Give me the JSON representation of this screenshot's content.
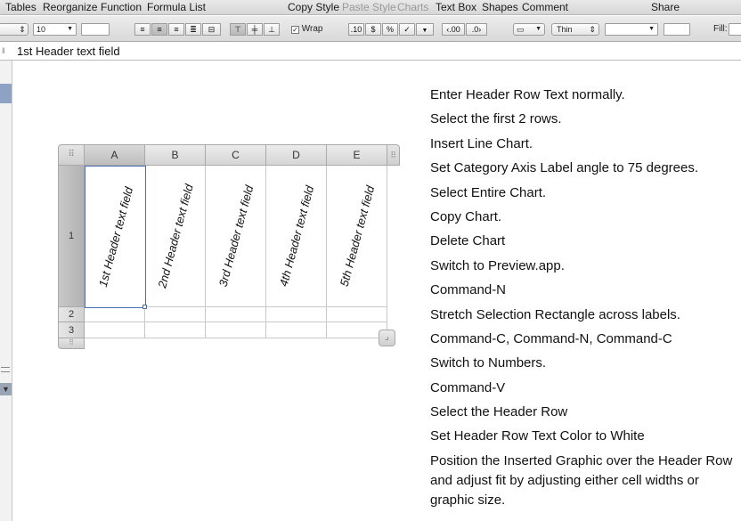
{
  "menubar": {
    "items": [
      {
        "label": "Tables",
        "dim": false
      },
      {
        "label": "Reorganize",
        "dim": false
      },
      {
        "label": "Function",
        "dim": false
      },
      {
        "label": "Formula List",
        "dim": false
      },
      {
        "label": "Copy Style",
        "dim": false
      },
      {
        "label": "Paste Style",
        "dim": true
      },
      {
        "label": "Charts",
        "dim": true
      },
      {
        "label": "Text Box",
        "dim": false
      },
      {
        "label": "Shapes",
        "dim": false
      },
      {
        "label": "Comment",
        "dim": false
      },
      {
        "label": "Share",
        "dim": false
      }
    ]
  },
  "formatbar": {
    "font_size": "10",
    "wrap_label": "Wrap",
    "number_formats": [
      ".10",
      "$",
      "%",
      "✓"
    ],
    "decimals": [
      "‹.00",
      ".0›"
    ],
    "stroke_weight": "Thin",
    "fill_label": "Fill:"
  },
  "formula": {
    "text": "1st Header text field"
  },
  "table": {
    "columns": [
      "A",
      "B",
      "C",
      "D",
      "E"
    ],
    "rows": [
      "1",
      "2",
      "3"
    ],
    "header_cells": [
      "1st Header text field",
      "2nd Header text field",
      "3rd Header text field",
      "4th Header text field",
      "5th Header text field"
    ],
    "selected_cell": "A1",
    "label_angle_degrees": 75
  },
  "steps": [
    "Enter Header Row Text normally.",
    "Select the first 2 rows.",
    "Insert Line Chart.",
    "Set Category Axis Label angle to 75 degrees.",
    "Select Entire Chart.",
    "Copy Chart.",
    "Delete Chart",
    "Switch to Preview.app.",
    "Command-N",
    "Stretch Selection Rectangle across labels.",
    "Command-C, Command-N, Command-C",
    "Switch to Numbers.",
    "Command-V",
    "Select the Header Row",
    "Set Header Row Text Color to White",
    "Position the Inserted Graphic over the Header Row and adjust fit by adjusting either cell widths or graphic size."
  ],
  "colors": {
    "selection_blue": "#4a6fae",
    "toolbar_gray": "#d9d9d9"
  }
}
